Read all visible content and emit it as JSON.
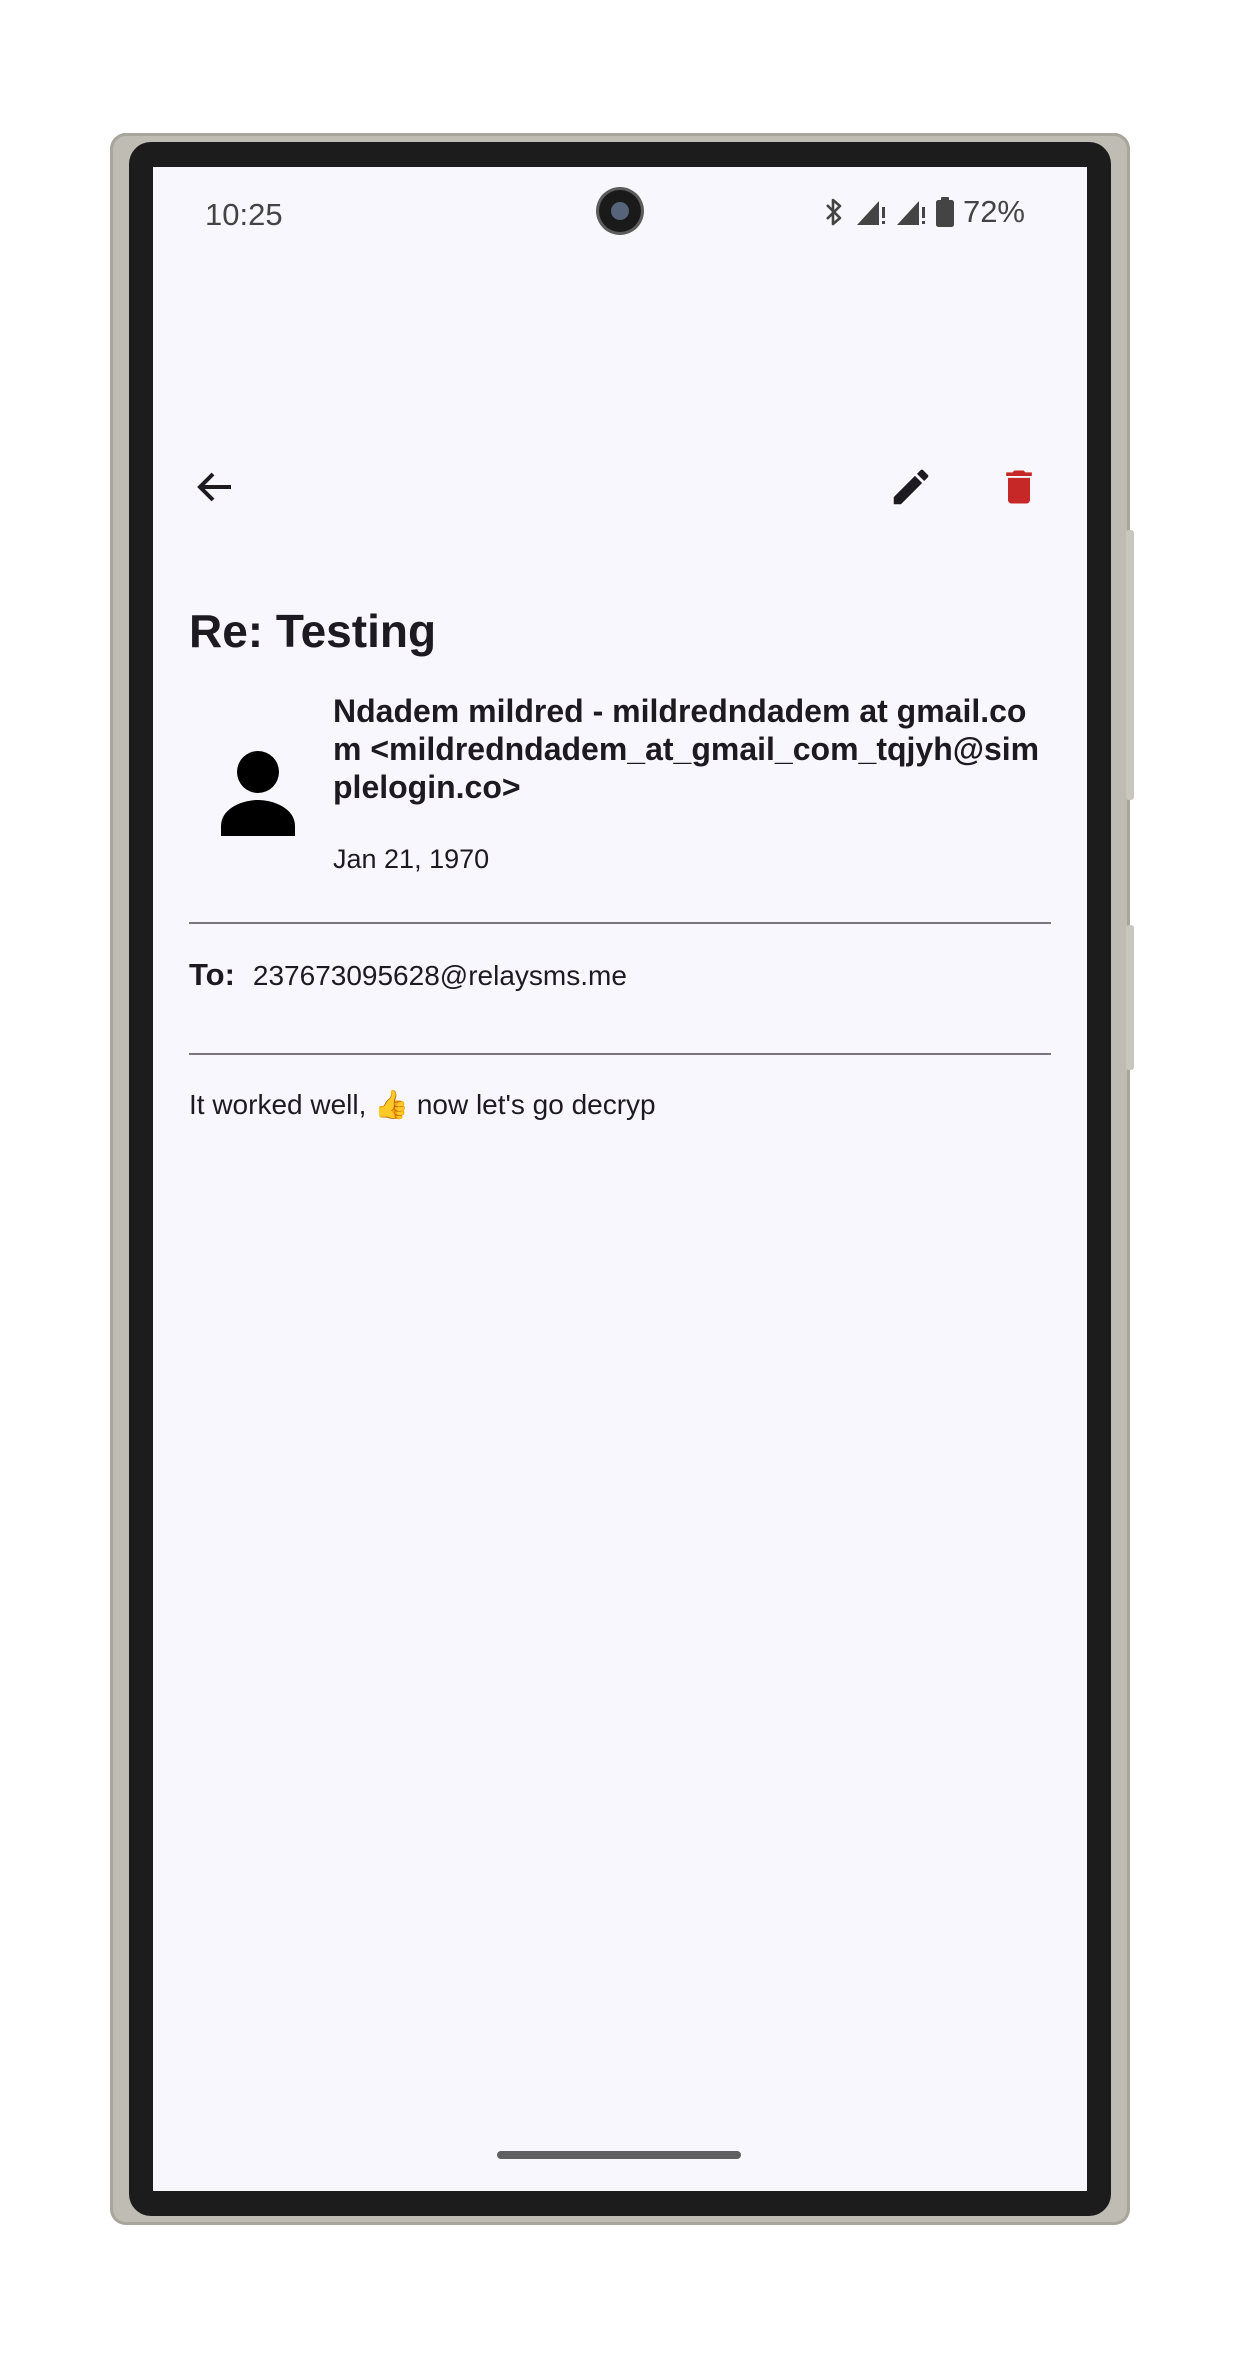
{
  "status_bar": {
    "time": "10:25",
    "battery": "72%",
    "icons": [
      "bluetooth-icon",
      "signal-icon",
      "signal-icon",
      "battery-icon"
    ]
  },
  "app_bar": {
    "back_icon": "arrow-back-icon",
    "edit_icon": "pencil-icon",
    "delete_icon": "trash-icon",
    "delete_color": "#c62828"
  },
  "email": {
    "subject": "Re: Testing",
    "sender": "Ndadem mildred - mildredndadem at gmail.com <mildredndadem_at_gmail_com_tqjyh@simplelogin.co>",
    "date": "Jan 21, 1970",
    "to_label": "To:",
    "to_value": "237673095628@relaysms.me",
    "body": "It worked well, 👍 now let's go decryp"
  }
}
